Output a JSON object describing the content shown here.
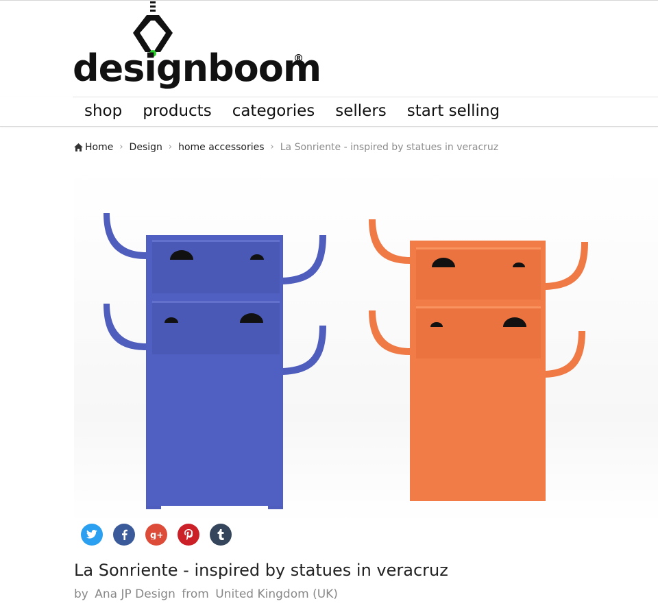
{
  "logo": {
    "wordmark": "designboom",
    "registered": "®"
  },
  "nav": {
    "items": [
      "shop",
      "products",
      "categories",
      "sellers",
      "start selling"
    ]
  },
  "breadcrumb": {
    "home": "Home",
    "items": [
      "Design",
      "home accessories"
    ],
    "current": "La Sonriente - inspired by statues in veracruz",
    "separator": "›"
  },
  "share": {
    "buttons": [
      {
        "name": "twitter",
        "glyph": "t",
        "color": "#2b9ff0"
      },
      {
        "name": "facebook",
        "glyph": "f",
        "color": "#3b5a9a"
      },
      {
        "name": "google-plus",
        "glyph": "g+",
        "color": "#dd4b39"
      },
      {
        "name": "pinterest",
        "glyph": "p",
        "color": "#cb2027"
      },
      {
        "name": "tumblr",
        "glyph": "t",
        "color": "#35465c"
      }
    ]
  },
  "product": {
    "title": "La Sonriente - inspired by statues in veracruz",
    "by_label": "by",
    "designer": "Ana JP Design",
    "from_label": "from",
    "country": "United Kingdom (UK)"
  },
  "colors": {
    "blue_cabinet": "#4f5dbd",
    "orange_cabinet": "#f07a45",
    "legs": "#e9d6b0"
  }
}
